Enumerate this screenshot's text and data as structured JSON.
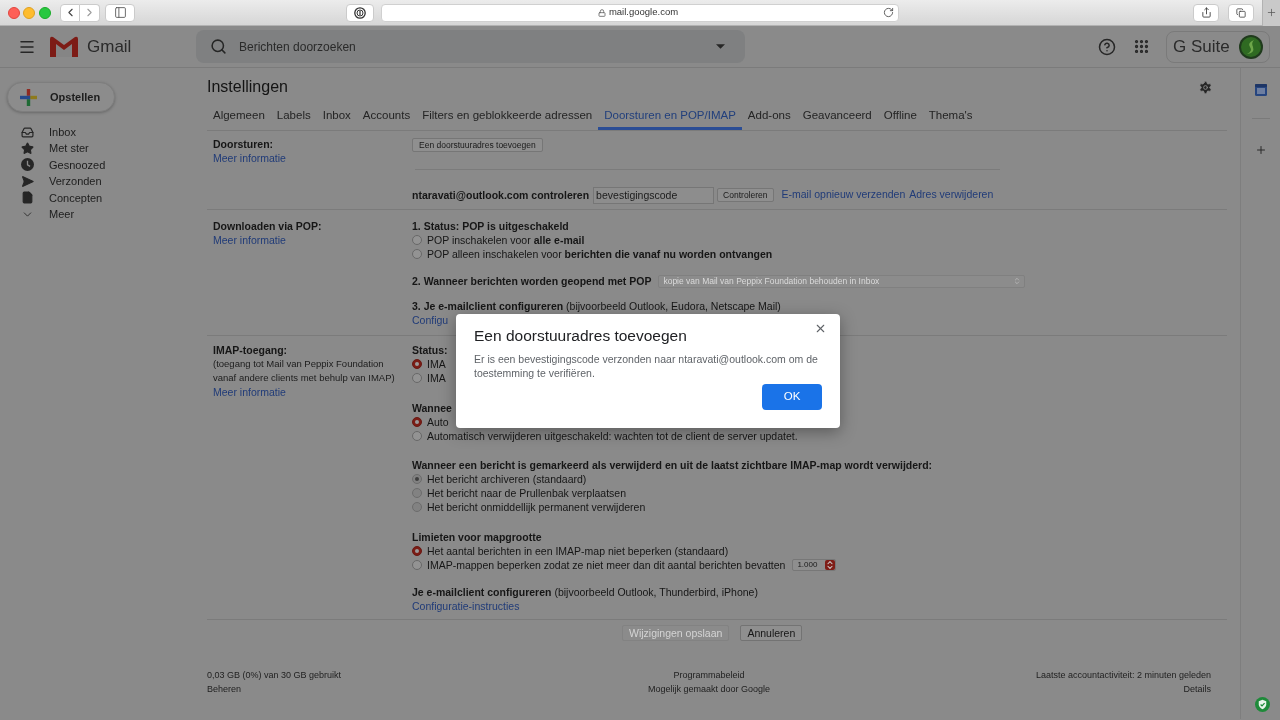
{
  "browser": {
    "address": "mail.google.com"
  },
  "header": {
    "app_name": "Gmail",
    "search": {
      "placeholder": "Berichten doorzoeken"
    },
    "product_name": "G Suite"
  },
  "sidebar": {
    "compose": "Opstellen",
    "items": [
      {
        "label": "Inbox"
      },
      {
        "label": "Met ster"
      },
      {
        "label": "Gesnoozed"
      },
      {
        "label": "Verzonden"
      },
      {
        "label": "Concepten"
      },
      {
        "label": "Meer"
      }
    ]
  },
  "settings": {
    "title": "Instellingen",
    "tabs": [
      {
        "label": "Algemeen",
        "selected": false
      },
      {
        "label": "Labels",
        "selected": false
      },
      {
        "label": "Inbox",
        "selected": false
      },
      {
        "label": "Accounts",
        "selected": false
      },
      {
        "label": "Filters en geblokkeerde adressen",
        "selected": false
      },
      {
        "label": "Doorsturen en POP/IMAP",
        "selected": true
      },
      {
        "label": "Add-ons",
        "selected": false
      },
      {
        "label": "Geavanceerd",
        "selected": false
      },
      {
        "label": "Offline",
        "selected": false
      },
      {
        "label": "Thema's",
        "selected": false
      }
    ]
  },
  "forwarding": {
    "label": "Doorsturen:",
    "link": "Meer informatie",
    "add_button": "Een doorstuuradres toevoegen",
    "verify_label": "ntaravati@outlook.com controleren",
    "code_field": {
      "placeholder": "bevestigingscode"
    },
    "verify_button": "Controleren",
    "links": [
      "E-mail opnieuw verzenden",
      "Adres verwijderen"
    ]
  },
  "pop": {
    "label": "Downloaden via POP:",
    "link": "Meer informatie",
    "status": "1. Status: POP is uitgeschakeld",
    "options": [
      {
        "text": "POP inschakelen voor **alle e-mail**",
        "selected": false
      },
      {
        "text": "POP alleen inschakelen voor **berichten die vanaf nu worden ontvangen**",
        "selected": false
      }
    ],
    "step2": {
      "label": "2. Wanneer berichten worden geopend met POP",
      "select": {
        "value": "kopie van Mail van Peppix Foundation behouden in Inbox",
        "disabled": true
      }
    },
    "step3": {
      "text": "**3. Je e-mailclient configureren** (bijvoorbeeld Outlook, Eudora, Netscape Mail)",
      "link": "Configu"
    }
  },
  "imap": {
    "label": "IMAP-toegang:",
    "note": "(toegang tot Mail van Peppix Foundation vanaf andere clients met behulp van IMAP)",
    "link": "Meer informatie",
    "status": {
      "label": "Status:",
      "options": [
        {
          "text": "IMA",
          "selected": true
        },
        {
          "text": "IMA",
          "selected": false
        }
      ]
    },
    "auto_expunge": {
      "label": "Wannee",
      "options": [
        {
          "text": "Auto",
          "selected": true
        },
        {
          "text": "Automatisch verwijderen uitgeschakeld: wachten tot de client de server updatet.",
          "selected": false
        }
      ]
    },
    "deletion": {
      "label": "Wanneer een bericht is gemarkeerd als verwijderd en uit de laatst zichtbare IMAP-map wordt verwijderd:",
      "disabled": true,
      "options": [
        {
          "text": "Het bericht archiveren (standaard)",
          "selected": true
        },
        {
          "text": "Het bericht naar de Prullenbak verplaatsen",
          "selected": false
        },
        {
          "text": "Het bericht onmiddellijk permanent verwijderen",
          "selected": false
        }
      ]
    },
    "folder_limits": {
      "label": "Limieten voor mapgrootte",
      "options": [
        {
          "text": "Het aantal berichten in een IMAP-map niet beperken (standaard)",
          "selected": true
        },
        {
          "text": "IMAP-mappen beperken zodat ze niet meer dan dit aantal berichten bevatten",
          "selected": false
        }
      ],
      "limit_select": {
        "value": "1.000"
      }
    },
    "client_config": {
      "text": "**Je e-mailclient configureren** (bijvoorbeeld Outlook, Thunderbird, iPhone)",
      "link": "Configuratie-instructies"
    }
  },
  "actions": [
    {
      "label": "Wijzigingen opslaan",
      "disabled": true
    },
    {
      "label": "Annuleren",
      "disabled": false
    }
  ],
  "footer": {
    "storage": "0,03 GB (0%) van 30 GB gebruikt",
    "manage": "Beheren",
    "policy": "Programmabeleid",
    "powered_by": "Mogelijk gemaakt door Google",
    "activity": "Laatste accountactiviteit: 2 minuten geleden",
    "details": "Details"
  },
  "dialog": {
    "title": "Een doorstuuradres toevoegen",
    "message": "Er is een bevestigingscode verzonden naar ntaravati@outlook.com om de toestemming te verifiëren.",
    "ok": "OK"
  }
}
